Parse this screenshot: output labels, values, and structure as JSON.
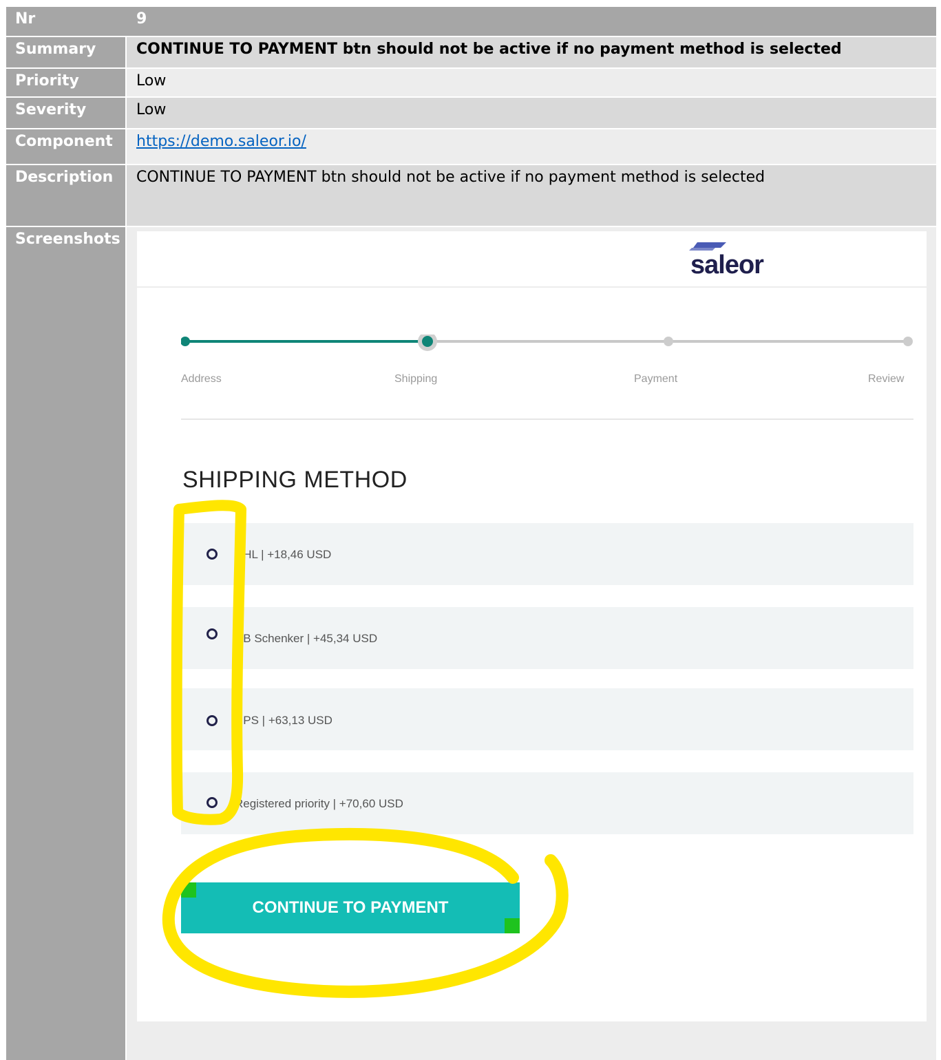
{
  "rows": {
    "nr": {
      "label": "Nr",
      "value": "9"
    },
    "summary": {
      "label": "Summary",
      "value": "CONTINUE TO PAYMENT btn should not be active if no payment method is selected"
    },
    "priority": {
      "label": "Priority",
      "value": "Low"
    },
    "severity": {
      "label": "Severity",
      "value": "Low"
    },
    "component": {
      "label": "Component",
      "value": "https://demo.saleor.io/"
    },
    "description": {
      "label": "Description",
      "value": "CONTINUE TO PAYMENT btn should not be active if no payment method is selected"
    },
    "screenshots": {
      "label": "Screenshots"
    }
  },
  "screenshot": {
    "logo": "saleor",
    "steps": [
      "Address",
      "Shipping",
      "Payment",
      "Review"
    ],
    "active_step_index": 1,
    "section_title": "SHIPPING METHOD",
    "options": [
      {
        "label": "DHL | +18,46 USD"
      },
      {
        "label": "DB Schenker | +45,34 USD"
      },
      {
        "label": "UPS | +63,13 USD"
      },
      {
        "label": "Registered priority | +70,60 USD"
      }
    ],
    "button_label": "CONTINUE TO PAYMENT"
  },
  "colors": {
    "label_bg": "#a6a6a6",
    "accent": "#14bdb5",
    "progress": "#0f8577",
    "highlight": "#ffe600",
    "link": "#0563c1"
  }
}
